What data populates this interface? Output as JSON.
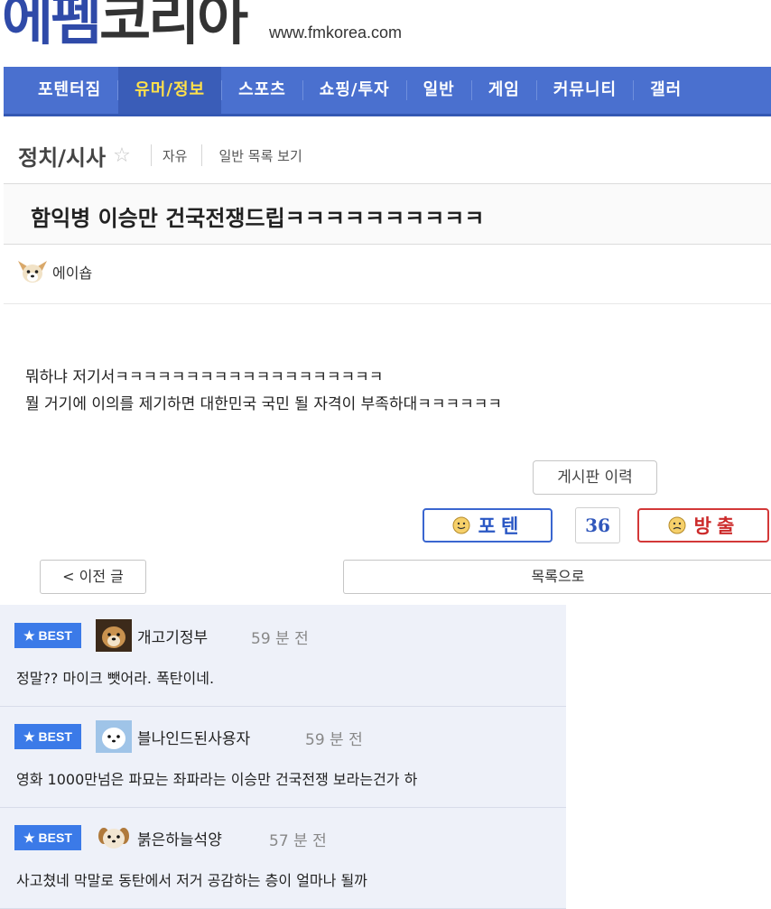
{
  "site": {
    "logo_part1": "에펨",
    "logo_part2": "코리아",
    "url": "www.fmkorea.com"
  },
  "nav": {
    "items": [
      "포텐터짐",
      "유머/정보",
      "스포츠",
      "쇼핑/투자",
      "일반",
      "게임",
      "커뮤니티",
      "갤러"
    ],
    "active": "유머/정보"
  },
  "board": {
    "title": "정치/시사",
    "star_icon": "☆",
    "links": [
      "자유",
      "일반 목록 보기"
    ]
  },
  "post": {
    "title": "함익병 이승만 건국전쟁드립ㅋㅋㅋㅋㅋㅋㅋㅋㅋㅋ",
    "author": "에이숍",
    "body_lines": [
      "뭐하냐 저기서ㅋㅋㅋㅋㅋㅋㅋㅋㅋㅋㅋㅋㅋㅋㅋㅋㅋㅋㅋ",
      "뭘 거기에 이의를 제기하면 대한민국 국민 될 자격이 부족하대ㅋㅋㅋㅋㅋㅋ"
    ],
    "history_button": "게시판 이력",
    "vote_up_label": "포텐",
    "vote_count": "36",
    "vote_down_label": "방출",
    "prev_button": "< 이전 글",
    "list_button": "목록으로"
  },
  "comments": [
    {
      "badge": "★ BEST",
      "name": "개고기정부",
      "time": "59 분 전",
      "text": "정말?? 마이크 뺏어라. 폭탄이네."
    },
    {
      "badge": "★ BEST",
      "name": "블나인드된사용자",
      "time": "59 분 전",
      "text": "영화 1000만넘은 파묘는 좌파라는 이승만 건국전쟁 보라는건가 하"
    },
    {
      "badge": "★ BEST",
      "name": "붉은하늘석양",
      "time": "57 분 전",
      "text": "사고쳤네 막말로 동탄에서 저거 공감하는 층이 얼마나 될까"
    }
  ],
  "colors": {
    "nav_bg": "#4a70cf",
    "nav_active_text": "#ffe14a",
    "best_badge": "#3b7ae8",
    "vote_up": "#2a57c4",
    "vote_down": "#cc2b2b"
  }
}
